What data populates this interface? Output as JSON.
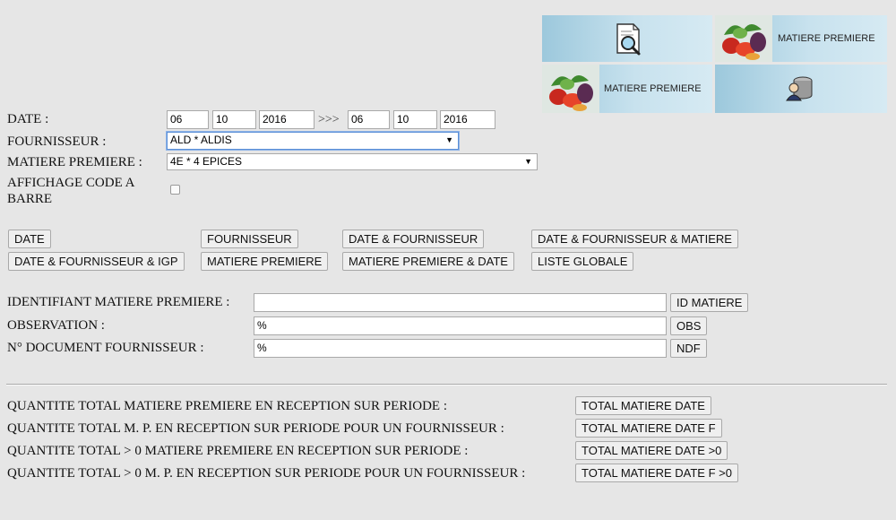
{
  "header_tiles": {
    "tile2_text": "MATIERE PREMIERE",
    "tile3_text": "MATIERE PREMIERE"
  },
  "form": {
    "date_label": "DATE :",
    "date_from_day": "06",
    "date_from_month": "10",
    "date_from_year": "2016",
    "date_separator": ">>>",
    "date_to_day": "06",
    "date_to_month": "10",
    "date_to_year": "2016",
    "fournisseur_label": "FOURNISSEUR :",
    "fournisseur_value": "ALD * ALDIS",
    "matiere_label": "MATIERE PREMIERE :",
    "matiere_value": "4E * 4 EPICES",
    "code_barre_label": "AFFICHAGE CODE A BARRE"
  },
  "search_buttons": {
    "date": "DATE",
    "fournisseur": "FOURNISSEUR",
    "date_fournisseur": "DATE & FOURNISSEUR",
    "date_fournisseur_matiere": "DATE & FOURNISSEUR & MATIERE",
    "date_fournisseur_igp": "DATE & FOURNISSEUR & IGP",
    "matiere_premiere": "MATIERE PREMIERE",
    "matiere_premiere_date": "MATIERE PREMIERE & DATE",
    "liste_globale": "LISTE GLOBALE"
  },
  "filters": {
    "identifiant_label": "IDENTIFIANT MATIERE PREMIERE :",
    "identifiant_value": "",
    "identifiant_button": "ID MATIERE",
    "observation_label": "OBSERVATION :",
    "observation_value": "%",
    "observation_button": "OBS",
    "document_label": "N° DOCUMENT FOURNISSEUR :",
    "document_value": "%",
    "document_button": "NDF"
  },
  "totals": {
    "row1_label": "QUANTITE TOTAL MATIERE PREMIERE EN RECEPTION SUR PERIODE :",
    "row1_button": "TOTAL MATIERE DATE",
    "row2_label": "QUANTITE TOTAL M. P. EN RECEPTION SUR PERIODE POUR UN FOURNISSEUR :",
    "row2_button": "TOTAL MATIERE DATE F",
    "row3_label": "QUANTITE TOTAL > 0 MATIERE PREMIERE EN RECEPTION SUR PERIODE :",
    "row3_button": "TOTAL MATIERE DATE >0",
    "row4_label": "QUANTITE TOTAL > 0 M. P. EN RECEPTION SUR PERIODE POUR UN FOURNISSEUR :",
    "row4_button": "TOTAL MATIERE DATE F >0"
  }
}
